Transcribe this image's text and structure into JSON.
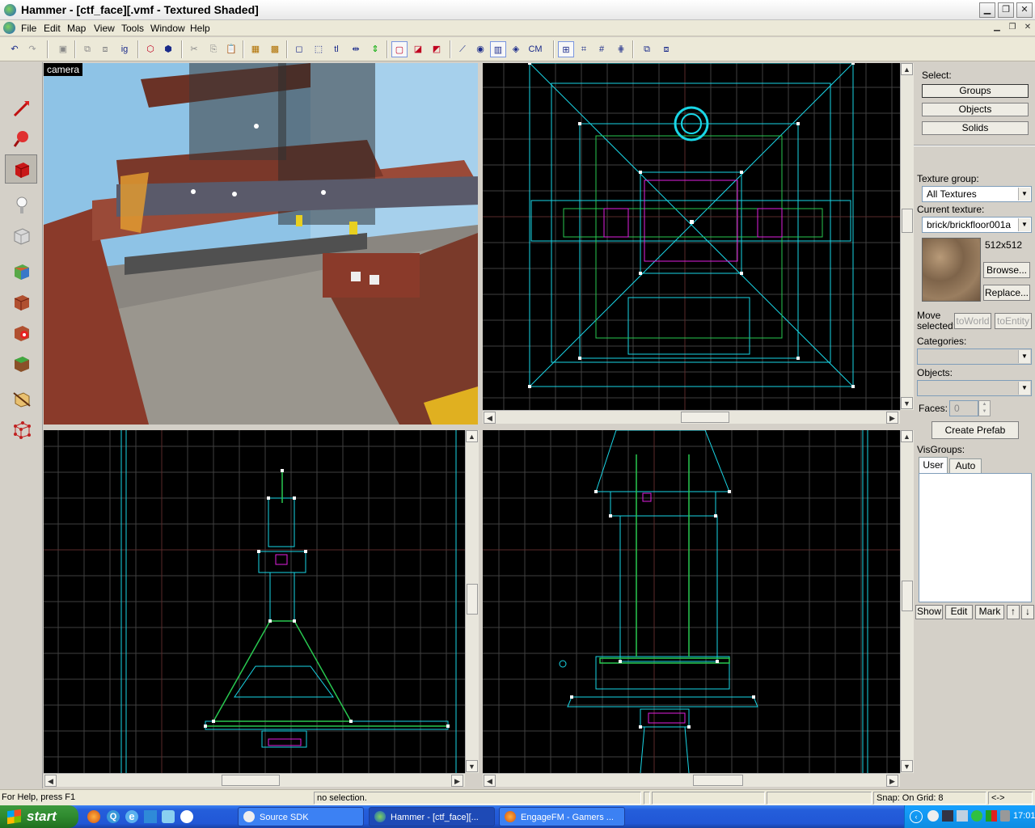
{
  "window": {
    "title": "Hammer - [ctf_face][.vmf - Textured Shaded]",
    "buttons": [
      "minimize",
      "maximize",
      "close"
    ]
  },
  "menu": [
    "File",
    "Edit",
    "Map",
    "View",
    "Tools",
    "Window",
    "Help"
  ],
  "toolbar": {
    "ig_label": "ig",
    "tl_label": "tl",
    "cm_label": "CM"
  },
  "palette_tools": [
    "selection-tool",
    "magnify-tool",
    "camera-tool",
    "entity-tool",
    "block-tool",
    "texture-application-tool",
    "apply-current-texture-tool",
    "decal-tool",
    "overlay-tool",
    "clipping-tool",
    "vertex-tool"
  ],
  "viewports": {
    "camera_label": "camera"
  },
  "right_panel": {
    "select_label": "Select:",
    "groups": "Groups",
    "objects": "Objects",
    "solids": "Solids",
    "texture_group_label": "Texture group:",
    "texture_group_value": "All Textures",
    "current_texture_label": "Current texture:",
    "current_texture_value": "brick/brickfloor001a",
    "texture_size": "512x512",
    "browse": "Browse...",
    "replace": "Replace...",
    "move_selected": "Move selected:",
    "to_world": "toWorld",
    "to_entity": "toEntity",
    "categories_label": "Categories:",
    "objects_label": "Objects:",
    "faces_label": "Faces:",
    "faces_value": "0",
    "create_prefab": "Create Prefab",
    "visgroups_label": "VisGroups:",
    "tab_user": "User",
    "tab_auto": "Auto",
    "show": "Show",
    "edit": "Edit",
    "mark": "Mark"
  },
  "status": {
    "help": "For Help, press F1",
    "selection": "no selection.",
    "snap": "Snap: On Grid: 8",
    "extra": "<->"
  },
  "taskbar": {
    "start": "start",
    "tasks": [
      "Source SDK",
      "Hammer - [ctf_face][...",
      "EngageFM - Gamers ..."
    ],
    "clock": "17:01"
  },
  "colors": {
    "grid_line": "#404040",
    "grid_major": "#5a2a2a",
    "brush_cyan": "#19d6e6",
    "brush_green": "#28c850",
    "brush_magenta": "#e020e0",
    "sky_blue": "#8ec3e6"
  }
}
